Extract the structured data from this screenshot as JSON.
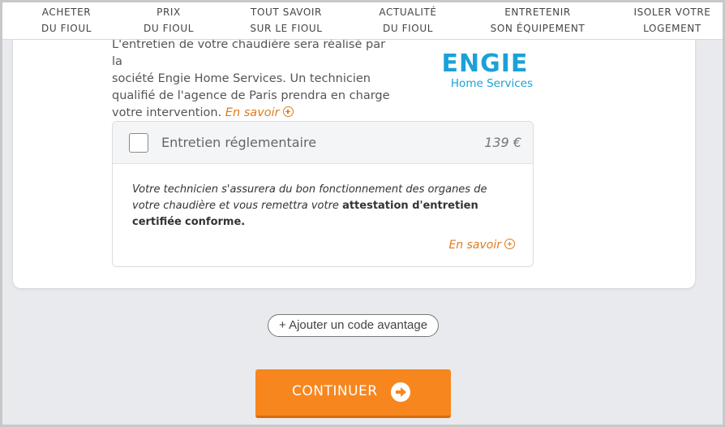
{
  "nav": {
    "items": [
      {
        "line1": "ACHETER",
        "line2": "DU FIOUL"
      },
      {
        "line1": "PRIX",
        "line2": "DU FIOUL"
      },
      {
        "line1": "TOUT SAVOIR",
        "line2": "SUR LE FIOUL"
      },
      {
        "line1": "ACTUALITÉ",
        "line2": "DU FIOUL"
      },
      {
        "line1": "ENTRETENIR",
        "line2": "SON ÉQUIPEMENT"
      },
      {
        "line1": "ISOLER VOTRE",
        "line2": "LOGEMENT"
      }
    ]
  },
  "intro": {
    "line1": "L'entretien de votre chaudière sera réalisé par la",
    "line2": "société Engie Home Services. Un technicien",
    "line3": "qualifié de l'agence de Paris prendra en charge",
    "line4": "votre intervention.",
    "more_link": "En savoir"
  },
  "logo": {
    "word": "ENGIE",
    "sub": "Home Services",
    "brand_color": "#1ba1d8"
  },
  "option": {
    "title": "Entretien réglementaire",
    "price": "139 €",
    "checked": false,
    "description_part1": "Votre technicien s'assurera du bon fonctionnement des organes de votre",
    "description_part2": "chaudière et vous remettra votre",
    "description_bold1": "attestation d'entretien certifiée",
    "description_bold2": "conforme.",
    "more_link": "En savoir"
  },
  "promo": {
    "label": "+ Ajouter un code avantage"
  },
  "cta": {
    "label": "CONTINUER",
    "icon": "arrow-right-circle-icon",
    "color": "#f7861e"
  },
  "colors": {
    "accent_orange": "#e07a1e",
    "background": "#e9eaee"
  }
}
